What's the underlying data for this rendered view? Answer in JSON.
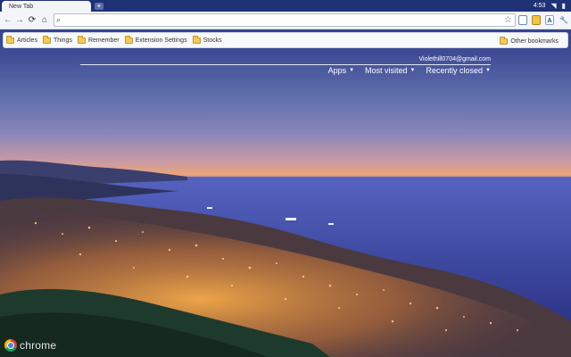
{
  "tab": {
    "title": "New Tab",
    "new_tab_glyph": "+"
  },
  "tray": {
    "time": "4:53"
  },
  "toolbar": {
    "back_glyph": "←",
    "forward_glyph": "→",
    "reload_glyph": "⟳",
    "home_glyph": "⌂",
    "search_glyph": "⌕",
    "omnibox_value": "",
    "star_glyph": "☆",
    "wrench_glyph": "🔧",
    "ext_a_glyph": "A"
  },
  "bookmarks": {
    "items": [
      {
        "label": "Articles"
      },
      {
        "label": "Things"
      },
      {
        "label": "Remember"
      },
      {
        "label": "Extension Settings"
      },
      {
        "label": "Stocks"
      }
    ],
    "other": "Other bookmarks"
  },
  "ntp": {
    "email": "Violethill0704@gmail.com",
    "menus": [
      {
        "label": "Apps"
      },
      {
        "label": "Most visited"
      },
      {
        "label": "Recently closed"
      }
    ],
    "caret": "▼"
  },
  "brand": {
    "text": "chrome"
  },
  "colors": {
    "tabstrip": "#1f3276",
    "toolbar": "#f3f5f8",
    "folder": "#f4c85a"
  }
}
